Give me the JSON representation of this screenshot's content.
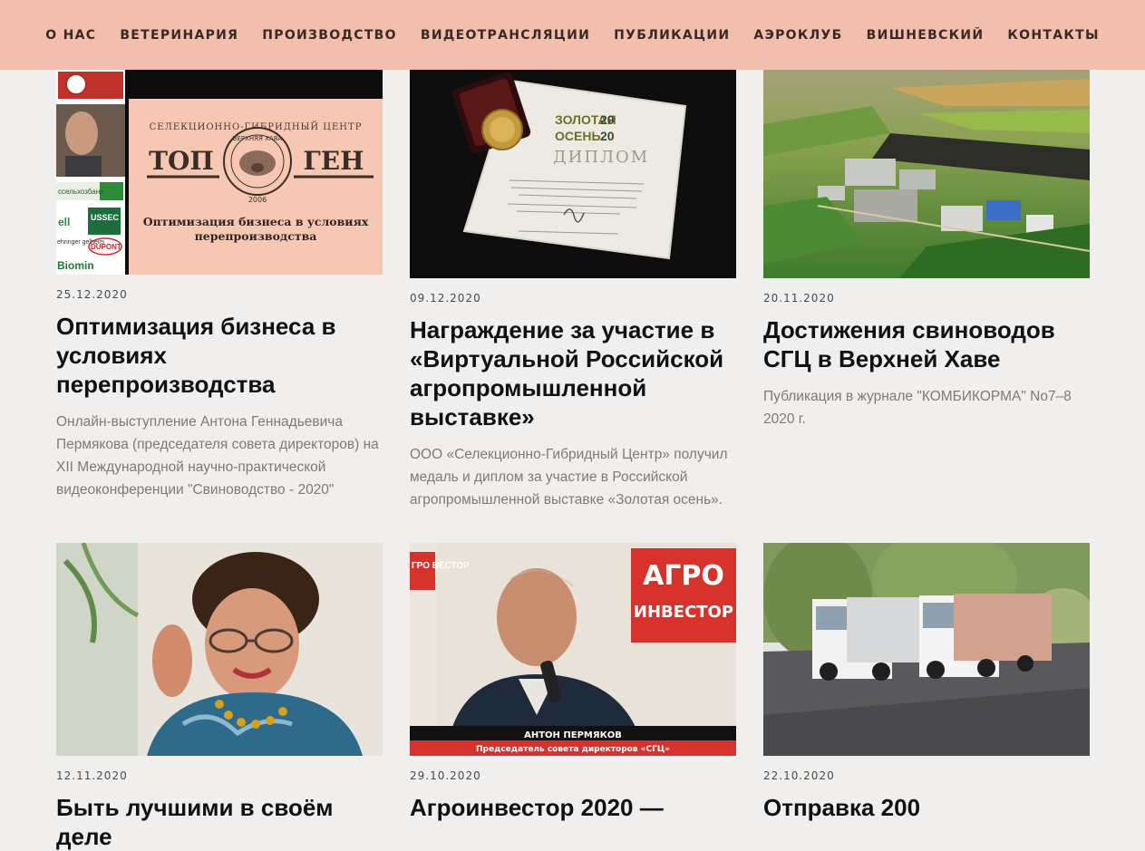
{
  "nav": {
    "items": [
      "О НАС",
      "ВЕТЕРИНАРИЯ",
      "ПРОИЗВОДСТВО",
      "ВИДЕОТРАНСЛЯЦИИ",
      "ПУБЛИКАЦИИ",
      "АЭРОКЛУБ",
      "ВИШНЕВСКИЙ",
      "КОНТАКТЫ"
    ]
  },
  "posts": [
    {
      "date": "25.12.2020",
      "title": "Оптимизация бизнеса в условиях перепроизводства",
      "excerpt": "Онлайн-выступление Антона Геннадьевича Пермякова (председателя совета директоров) на XII Международной научно-практической видеоконференции \"Свиноводство - 2020\"",
      "image": {
        "arc_text": "СЕЛЕКЦИОННО-ГИБРИДНЫЙ ЦЕНТР",
        "logo_left": "ТОП",
        "logo_right": "ГЕН",
        "logo_ring": "ВЕРХНЯЯ ХАВА",
        "logo_year": "2006",
        "slide_caption": "Оптимизация бизнеса в условиях перепроизводства",
        "sponsors": [
          "ссельхозбанк",
          "ell",
          "USSEC",
          "ehringer gelheim",
          "DUPONT",
          "Biomin"
        ]
      }
    },
    {
      "date": "09.12.2020",
      "title": "Награждение за участие в «Виртуальной Российской агропромышленной выставке»",
      "excerpt": "ООО «Селекционно-Гибридный Центр» получил медаль и диплом за участие в Российской агропромышленной выставке «Золотая осень».",
      "image": {
        "diploma_line1": "ЗОЛОТАЯ",
        "diploma_line2": "ОСЕНЬ",
        "diploma_year_a": "20",
        "diploma_year_b": "20",
        "diploma_word": "ДИПЛОМ"
      }
    },
    {
      "date": "20.11.2020",
      "title": "Достижения свиноводов СГЦ в Верхней Хаве",
      "excerpt": "Публикация в журнале \"КОМБИКОРМА\" No7–8 2020 г."
    },
    {
      "date": "12.11.2020",
      "title": "Быть лучшими в своём деле",
      "excerpt": ""
    },
    {
      "date": "29.10.2020",
      "title": "Агроинвестор 2020 —",
      "excerpt": "",
      "image": {
        "banner_line1": "АГРО",
        "banner_line2": "ИНВЕСТОР",
        "side_text": "ГРО ВЕСТОР",
        "caption_name": "АНТОН ПЕРМЯКОВ",
        "caption_role": "Председатель совета директоров «СГЦ»"
      }
    },
    {
      "date": "22.10.2020",
      "title": "Отправка 200",
      "excerpt": ""
    }
  ],
  "colors": {
    "nav_bg": "#f2bfaf",
    "page_bg": "#f1efed",
    "accent_red": "#d8322c"
  }
}
